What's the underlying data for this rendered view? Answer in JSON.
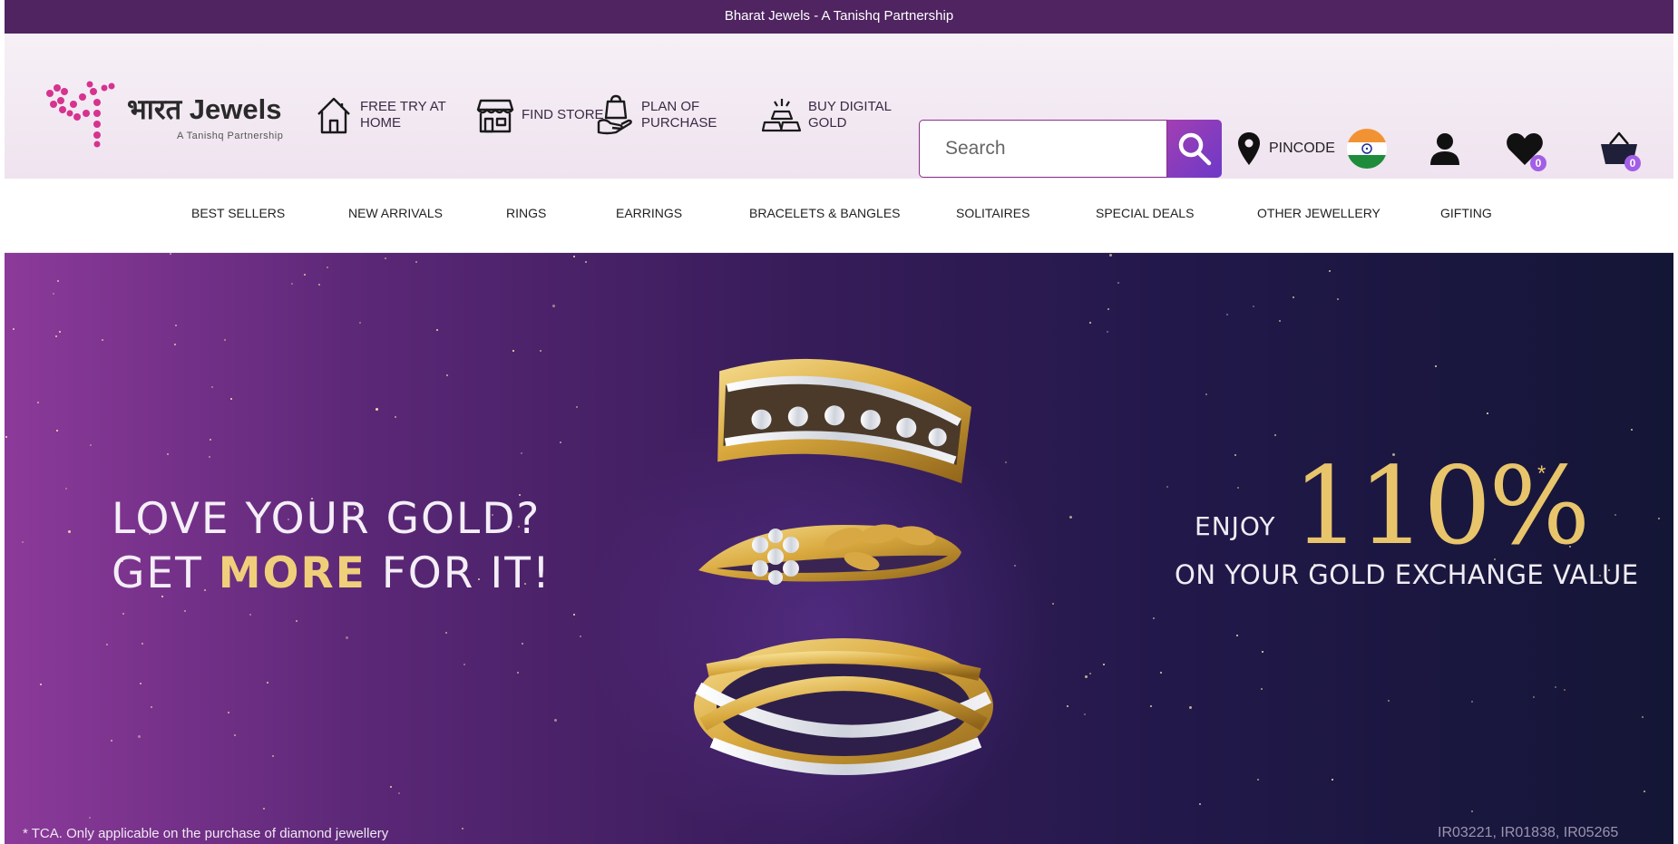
{
  "topbar": {
    "text": "Bharat Jewels - A Tanishq Partnership"
  },
  "header": {
    "logo": {
      "name": "भारत Jewels",
      "tagline": "A Tanishq Partnership"
    },
    "links": [
      {
        "label": "FREE TRY AT HOME",
        "icon": "home-icon"
      },
      {
        "label": "FIND STORE",
        "icon": "store-icon"
      },
      {
        "label": "PLAN OF PURCHASE",
        "icon": "bag-in-hand-icon"
      },
      {
        "label": "BUY DIGITAL GOLD",
        "icon": "gold-bars-icon"
      }
    ],
    "search": {
      "placeholder": "Search",
      "value": ""
    },
    "pincode_label": "PINCODE",
    "wishlist_count": "0",
    "cart_count": "0"
  },
  "nav": {
    "items": [
      "BEST SELLERS",
      "NEW ARRIVALS",
      "RINGS",
      "EARRINGS",
      "BRACELETS & BANGLES",
      "SOLITAIRES",
      "SPECIAL DEALS",
      "OTHER JEWELLERY",
      "GIFTING"
    ]
  },
  "hero": {
    "line1": "LOVE YOUR GOLD?",
    "line2_before": "GET ",
    "line2_highlight": "MORE",
    "line2_after": " FOR IT!",
    "enjoy": "ENJOY",
    "percent": "110%",
    "asterisk": "*",
    "exchange": "ON YOUR GOLD EXCHANGE VALUE",
    "tca": "* TCA. Only applicable on the purchase of diamond jewellery",
    "codes": "IR03221, IR01838, IR05265"
  },
  "colors": {
    "topbar": "#4f2461",
    "accent": "#8b2f8b",
    "gold": "#e8c56b",
    "badge": "#a25fe6"
  }
}
